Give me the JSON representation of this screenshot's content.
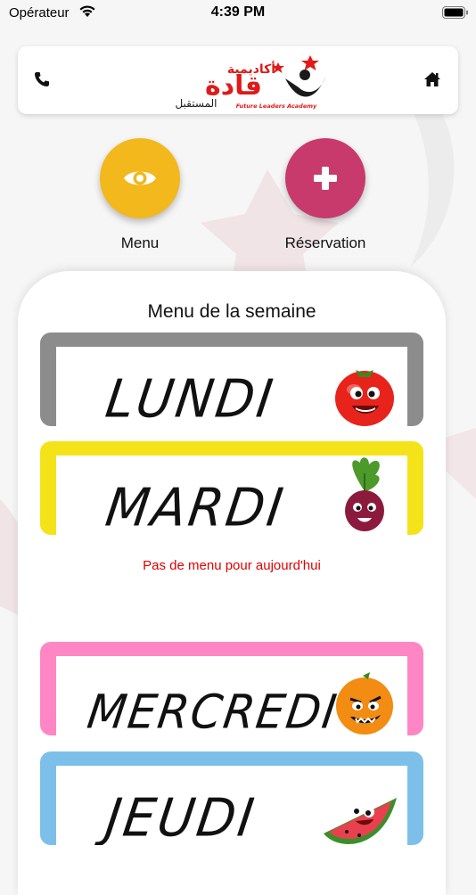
{
  "status_bar": {
    "carrier": "Opérateur",
    "time": "4:39 PM"
  },
  "header": {
    "logo_arabic_top": "أكاديمية",
    "logo_arabic_main": "قادة",
    "logo_arabic_bottom": "المستقبل",
    "logo_english": "Future Leaders Academy"
  },
  "actions": [
    {
      "label": "Menu",
      "color": "#f2b81c",
      "icon": "eye-icon"
    },
    {
      "label": "Réservation",
      "color": "#c83a6b",
      "icon": "plus-icon"
    }
  ],
  "menu": {
    "title": "Menu de la semaine",
    "empty_message": "Pas de menu pour aujourd'hui",
    "empty_color": "#e00000",
    "days": [
      {
        "name": "LUNDI",
        "border_color": "#8c8c8c",
        "mascot": "tomato-icon"
      },
      {
        "name": "MARDI",
        "border_color": "#f5e31a",
        "mascot": "beet-icon"
      },
      {
        "name": "MERCREDI",
        "border_color": "#ff86c4",
        "mascot": "orange-icon"
      },
      {
        "name": "JEUDI",
        "border_color": "#7cc0ea",
        "mascot": "watermelon-icon"
      }
    ]
  }
}
